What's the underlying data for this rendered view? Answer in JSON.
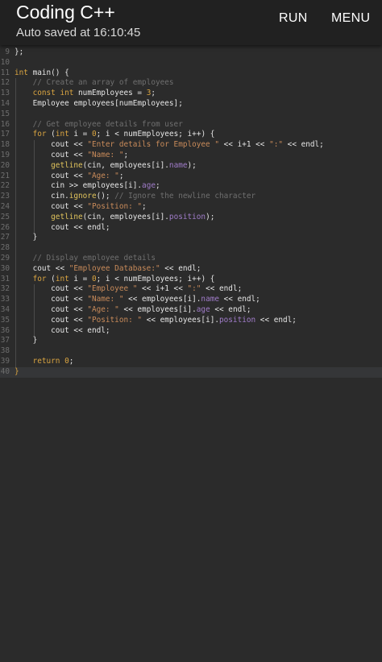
{
  "app": {
    "title": "Coding C++",
    "autosave": "Auto saved at 16:10:45",
    "run_label": "RUN",
    "menu_label": "MENU"
  },
  "editor": {
    "language": "C++",
    "current_line": 40,
    "lines": [
      {
        "n": "9",
        "segs": [
          [
            "p",
            "};"
          ]
        ]
      },
      {
        "n": "10",
        "segs": []
      },
      {
        "n": "11",
        "segs": [
          [
            "k",
            "int"
          ],
          [
            "p",
            " main() {"
          ]
        ]
      },
      {
        "n": "12",
        "segs": [
          [
            "p",
            "    "
          ],
          [
            "c",
            "// Create an array of employees"
          ]
        ]
      },
      {
        "n": "13",
        "segs": [
          [
            "p",
            "    "
          ],
          [
            "k",
            "const int"
          ],
          [
            "p",
            " numEmployees = "
          ],
          [
            "n",
            "3"
          ],
          [
            "p",
            ";"
          ]
        ]
      },
      {
        "n": "14",
        "segs": [
          [
            "p",
            "    Employee employees[numEmployees];"
          ]
        ]
      },
      {
        "n": "15",
        "segs": []
      },
      {
        "n": "16",
        "segs": [
          [
            "p",
            "    "
          ],
          [
            "c",
            "// Get employee details from user"
          ]
        ]
      },
      {
        "n": "17",
        "segs": [
          [
            "p",
            "    "
          ],
          [
            "k",
            "for"
          ],
          [
            "p",
            " ("
          ],
          [
            "k",
            "int"
          ],
          [
            "p",
            " i = "
          ],
          [
            "n",
            "0"
          ],
          [
            "p",
            "; i < numEmployees; i++) {"
          ]
        ]
      },
      {
        "n": "18",
        "segs": [
          [
            "p",
            "        cout << "
          ],
          [
            "s",
            "\"Enter details for Employee \""
          ],
          [
            "p",
            " << i+1 << "
          ],
          [
            "s",
            "\":\""
          ],
          [
            "p",
            " << endl;"
          ]
        ]
      },
      {
        "n": "19",
        "segs": [
          [
            "p",
            "        cout << "
          ],
          [
            "s",
            "\"Name: \""
          ],
          [
            "p",
            ";"
          ]
        ]
      },
      {
        "n": "20",
        "segs": [
          [
            "p",
            "        "
          ],
          [
            "f",
            "getline"
          ],
          [
            "p",
            "(cin, employees[i]."
          ],
          [
            "m",
            "name"
          ],
          [
            "p",
            ");"
          ]
        ]
      },
      {
        "n": "21",
        "segs": [
          [
            "p",
            "        cout << "
          ],
          [
            "s",
            "\"Age: \""
          ],
          [
            "p",
            ";"
          ]
        ]
      },
      {
        "n": "22",
        "segs": [
          [
            "p",
            "        cin >> employees[i]."
          ],
          [
            "m",
            "age"
          ],
          [
            "p",
            ";"
          ]
        ]
      },
      {
        "n": "23",
        "segs": [
          [
            "p",
            "        cin."
          ],
          [
            "f",
            "ignore"
          ],
          [
            "p",
            "(); "
          ],
          [
            "c",
            "// Ignore the newline character"
          ]
        ]
      },
      {
        "n": "24",
        "segs": [
          [
            "p",
            "        cout << "
          ],
          [
            "s",
            "\"Position: \""
          ],
          [
            "p",
            ";"
          ]
        ]
      },
      {
        "n": "25",
        "segs": [
          [
            "p",
            "        "
          ],
          [
            "f",
            "getline"
          ],
          [
            "p",
            "(cin, employees[i]."
          ],
          [
            "m",
            "position"
          ],
          [
            "p",
            ");"
          ]
        ]
      },
      {
        "n": "26",
        "segs": [
          [
            "p",
            "        cout << endl;"
          ]
        ]
      },
      {
        "n": "27",
        "segs": [
          [
            "p",
            "    }"
          ]
        ]
      },
      {
        "n": "28",
        "segs": []
      },
      {
        "n": "29",
        "segs": [
          [
            "p",
            "    "
          ],
          [
            "c",
            "// Display employee details"
          ]
        ]
      },
      {
        "n": "30",
        "segs": [
          [
            "p",
            "    cout << "
          ],
          [
            "s",
            "\"Employee Database:\""
          ],
          [
            "p",
            " << endl;"
          ]
        ]
      },
      {
        "n": "31",
        "segs": [
          [
            "p",
            "    "
          ],
          [
            "k",
            "for"
          ],
          [
            "p",
            " ("
          ],
          [
            "k",
            "int"
          ],
          [
            "p",
            " i = "
          ],
          [
            "n",
            "0"
          ],
          [
            "p",
            "; i < numEmployees; i++) {"
          ]
        ]
      },
      {
        "n": "32",
        "segs": [
          [
            "p",
            "        cout << "
          ],
          [
            "s",
            "\"Employee \""
          ],
          [
            "p",
            " << i+1 << "
          ],
          [
            "s",
            "\":\""
          ],
          [
            "p",
            " << endl;"
          ]
        ]
      },
      {
        "n": "33",
        "segs": [
          [
            "p",
            "        cout << "
          ],
          [
            "s",
            "\"Name: \""
          ],
          [
            "p",
            " << employees[i]."
          ],
          [
            "m",
            "name"
          ],
          [
            "p",
            " << endl;"
          ]
        ]
      },
      {
        "n": "34",
        "segs": [
          [
            "p",
            "        cout << "
          ],
          [
            "s",
            "\"Age: \""
          ],
          [
            "p",
            " << employees[i]."
          ],
          [
            "m",
            "age"
          ],
          [
            "p",
            " << endl;"
          ]
        ]
      },
      {
        "n": "35",
        "segs": [
          [
            "p",
            "        cout << "
          ],
          [
            "s",
            "\"Position: \""
          ],
          [
            "p",
            " << employees[i]."
          ],
          [
            "m",
            "position"
          ],
          [
            "p",
            " << endl;"
          ]
        ]
      },
      {
        "n": "36",
        "segs": [
          [
            "p",
            "        cout << endl;"
          ]
        ]
      },
      {
        "n": "37",
        "segs": [
          [
            "p",
            "    }"
          ]
        ]
      },
      {
        "n": "38",
        "segs": []
      },
      {
        "n": "39",
        "segs": [
          [
            "p",
            "    "
          ],
          [
            "k",
            "return"
          ],
          [
            "p",
            " "
          ],
          [
            "n",
            "0"
          ],
          [
            "p",
            ";"
          ]
        ]
      },
      {
        "n": "40",
        "segs": [
          [
            "k",
            "}"
          ]
        ]
      }
    ]
  },
  "colors": {
    "background": "#2b2b2b",
    "appbar": "#212121",
    "keyword": "#d9a441",
    "string": "#c98b5a",
    "comment": "#6f6f6f",
    "function": "#e0c35c",
    "member": "#a07cc9"
  }
}
